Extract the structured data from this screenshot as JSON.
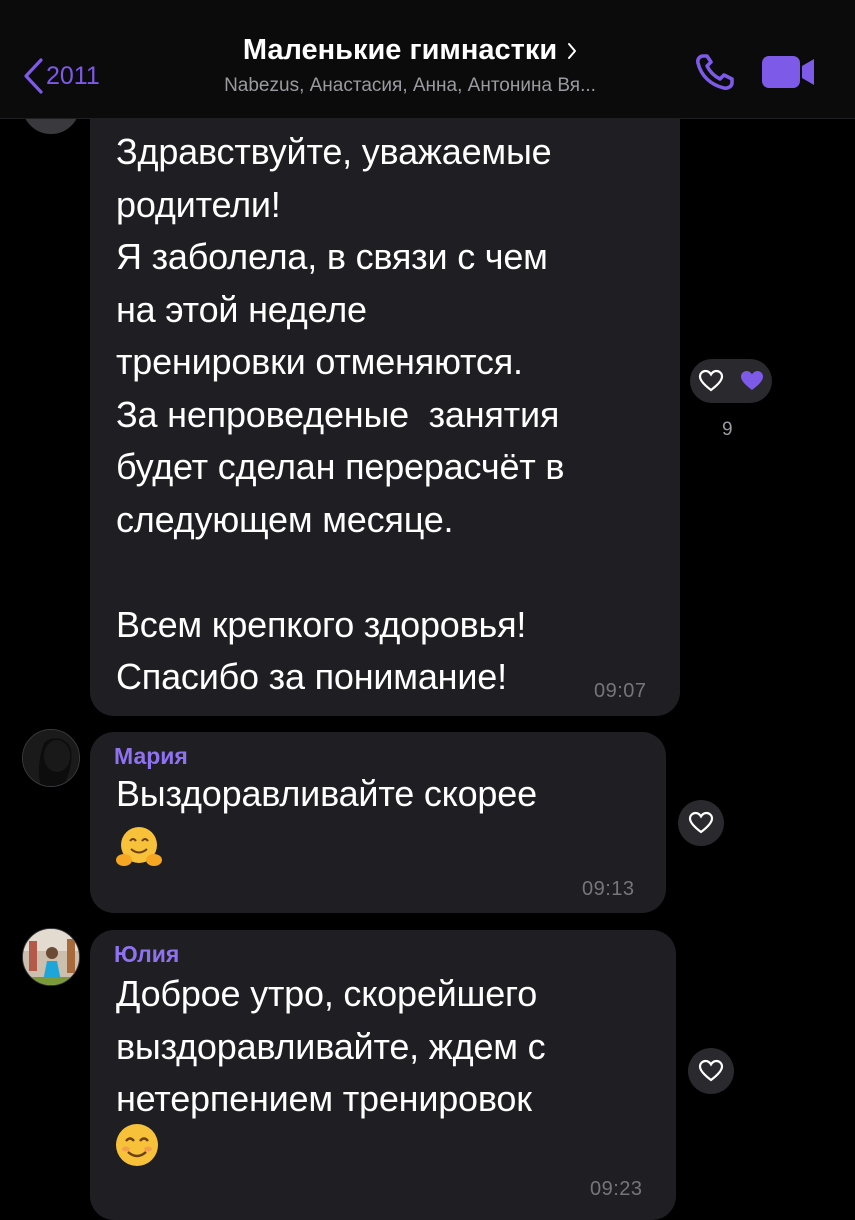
{
  "header": {
    "back_count": "2011",
    "title": "Маленькие гимнастки",
    "subtitle": "Nabezus, Анастасия, Анна, Антонина Вя..."
  },
  "messages": [
    {
      "text": "Здравствуйте, уважаемые\nродители!\nЯ заболела, в связи с чем\nна этой неделе\nтренировки отменяются.\nЗа непроведеные  занятия\nбудет сделан перерасчёт в\nследующем месяце.\n\nВсем крепкого здоровья!\nСпасибо за понимание!",
      "time": "09:07",
      "reaction_count": "9",
      "reactions": [
        "heart-outline-icon",
        "purple-heart-icon"
      ]
    },
    {
      "sender": "Мария",
      "text": "Выздоравливайте скорее",
      "emoji": "hugging-face-emoji",
      "time": "09:13"
    },
    {
      "sender": "Юлия",
      "text": "Доброе утро, скорейшего\nвыздоравливайте, ждем с\nнетерпением тренировок",
      "emoji": "smiling-face-emoji",
      "time": "09:23"
    }
  ],
  "colors": {
    "background": "#000000",
    "bubble": "#1f1f23",
    "accent": "#7d5ae8",
    "sender_name": "#8f72f0",
    "time": "#75757a"
  }
}
